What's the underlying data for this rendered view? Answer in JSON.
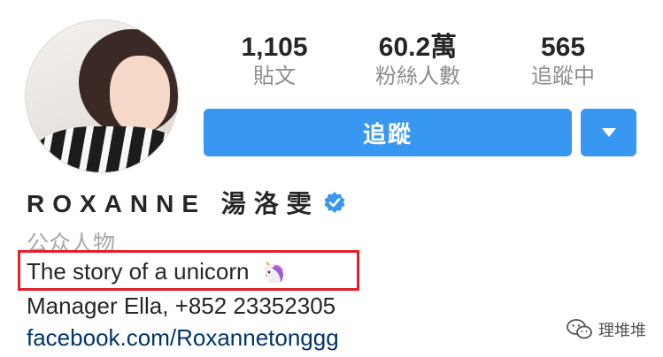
{
  "profile": {
    "stats": [
      {
        "value": "1,105",
        "label": "貼文"
      },
      {
        "value": "60.2萬",
        "label": "粉絲人數"
      },
      {
        "value": "565",
        "label": "追蹤中"
      }
    ],
    "follow_label": "追蹤",
    "name": "ROXANNE 湯洛雯",
    "category": "公众人物",
    "bio": "The story of a unicorn",
    "contact": "Manager Ella, +852 23352305",
    "link": "facebook.com/Roxannetonggg"
  },
  "watermark": {
    "text": "理堆堆"
  },
  "colors": {
    "accent": "#3897f0",
    "highlight_box": "#e0202a",
    "link": "#003569"
  },
  "icons": {
    "verified": "verified-badge-icon",
    "dropdown": "chevron-down-icon",
    "unicorn": "unicorn-emoji-icon",
    "watermark": "wechat-icon"
  }
}
